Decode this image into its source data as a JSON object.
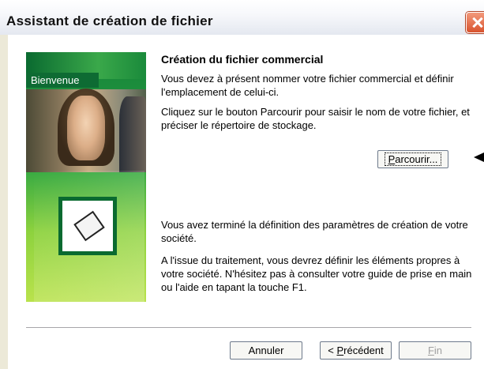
{
  "window": {
    "title": "Assistant de création de fichier",
    "close_icon": "close-icon"
  },
  "sidebar": {
    "banner": "Bienvenue",
    "icon": "document-icon"
  },
  "content": {
    "heading": "Création du fichier commercial",
    "paragraph1": "Vous devez à présent nommer votre fichier commercial et définir l'emplacement de celui-ci.",
    "paragraph2": "Cliquez sur le bouton Parcourir pour saisir le nom de votre fichier, et préciser le répertoire de stockage.",
    "browse_button": {
      "accel": "P",
      "rest": "arcourir..."
    },
    "paragraph3": "Vous avez terminé la définition des paramètres de création de votre société.",
    "paragraph4": "A l'issue du traitement, vous devrez définir les éléments propres à votre société. N'hésitez pas à consulter votre guide de prise en main ou l'aide en tapant la touche F1."
  },
  "footer": {
    "cancel": "Annuler",
    "previous": {
      "prefix": "< ",
      "accel": "P",
      "rest": "récédent"
    },
    "finish": {
      "accel": "F",
      "rest": "in"
    }
  }
}
